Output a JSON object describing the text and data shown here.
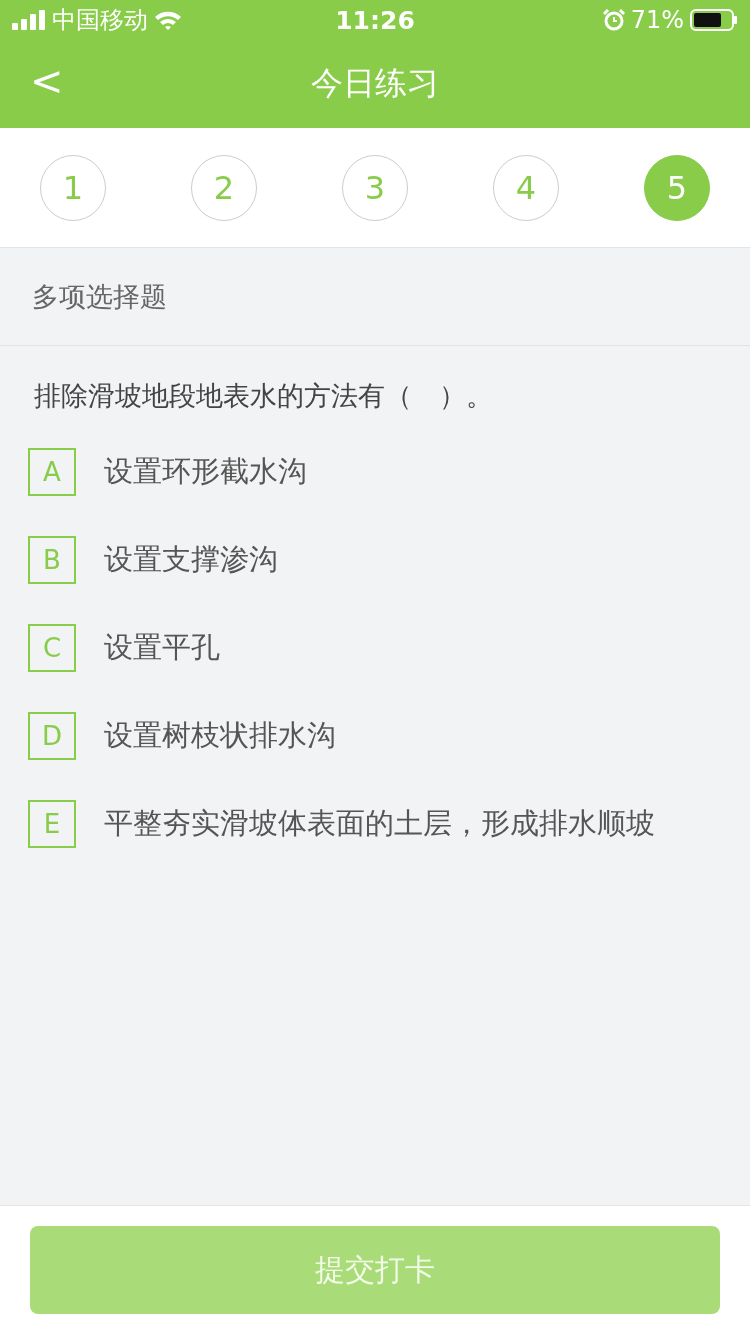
{
  "status_bar": {
    "carrier": "中国移动",
    "time": "11:26",
    "battery": "71%"
  },
  "nav": {
    "back": "<",
    "title": "今日练习"
  },
  "steps": [
    {
      "label": "1",
      "selected": false
    },
    {
      "label": "2",
      "selected": false
    },
    {
      "label": "3",
      "selected": false
    },
    {
      "label": "4",
      "selected": false
    },
    {
      "label": "5",
      "selected": true
    }
  ],
  "section": "多项选择题",
  "question": "排除滑坡地段地表水的方法有（　）。",
  "options": [
    {
      "letter": "A",
      "text": "设置环形截水沟",
      "selected": false
    },
    {
      "letter": "B",
      "text": "设置支撑渗沟",
      "selected": false
    },
    {
      "letter": "C",
      "text": "设置平孔",
      "selected": false
    },
    {
      "letter": "D",
      "text": "设置树枝状排水沟",
      "selected": false
    },
    {
      "letter": "E",
      "text": "平整夯实滑坡体表面的土层，形成排水顺坡",
      "selected": false
    }
  ],
  "submit": {
    "label": "提交打卡",
    "disabled": true
  }
}
